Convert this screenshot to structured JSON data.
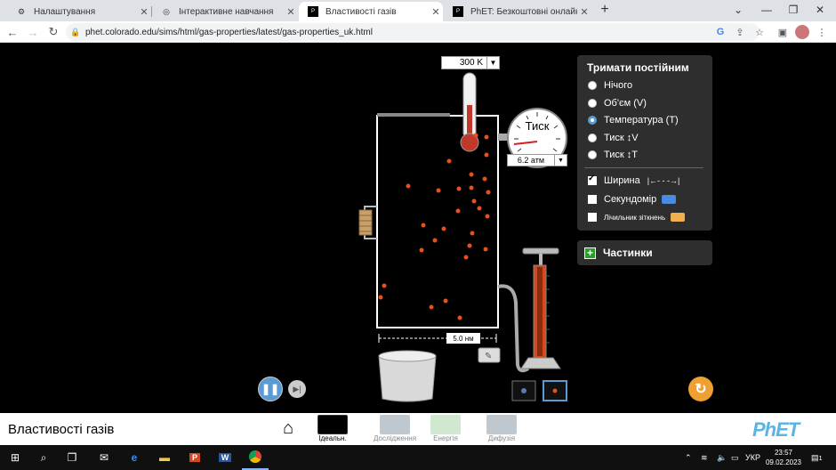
{
  "browser": {
    "tabs": [
      {
        "title": "Налаштування",
        "icon": "settings-icon"
      },
      {
        "title": "Інтерактивне навчання",
        "icon": "globe-icon"
      },
      {
        "title": "Властивості газів",
        "icon": "phet-icon"
      },
      {
        "title": "PhET: Безкоштовні онлайнові м",
        "icon": "phet-icon"
      }
    ],
    "url": "phet.colorado.edu/sims/html/gas-properties/latest/gas-properties_uk.html"
  },
  "sim": {
    "thermometer_value": "300 K",
    "gauge_title": "Тиск",
    "gauge_value": "6.2 атм",
    "width_value": "5.0 нм",
    "control_panel": {
      "title": "Тримати постійним",
      "options": [
        "Нічого",
        "Об'єм (V)",
        "Температура (T)",
        "Тиск ↕V",
        "Тиск ↕T"
      ],
      "selected_index": 2,
      "checkboxes": [
        {
          "label": "Ширина",
          "checked": true
        },
        {
          "label": "Секундомір",
          "checked": false
        },
        {
          "label": "Лічильник зіткнень",
          "checked": false
        }
      ]
    },
    "particles_panel_label": "Частинки",
    "colors": {
      "particle": "#e8501e",
      "accent": "#5b9bd5",
      "panel": "#2e2e2e"
    }
  },
  "navbar": {
    "sim_title": "Властивості газів",
    "screens": [
      {
        "label": "Ідеальн.",
        "active": true
      },
      {
        "label": "Дослідження",
        "active": false
      },
      {
        "label": "Енергія",
        "active": false
      },
      {
        "label": "Дифузія",
        "active": false
      }
    ],
    "brand": "PhET"
  },
  "taskbar": {
    "language": "УКР",
    "time": "23:57",
    "date": "09.02.2023",
    "notifications": "1"
  }
}
